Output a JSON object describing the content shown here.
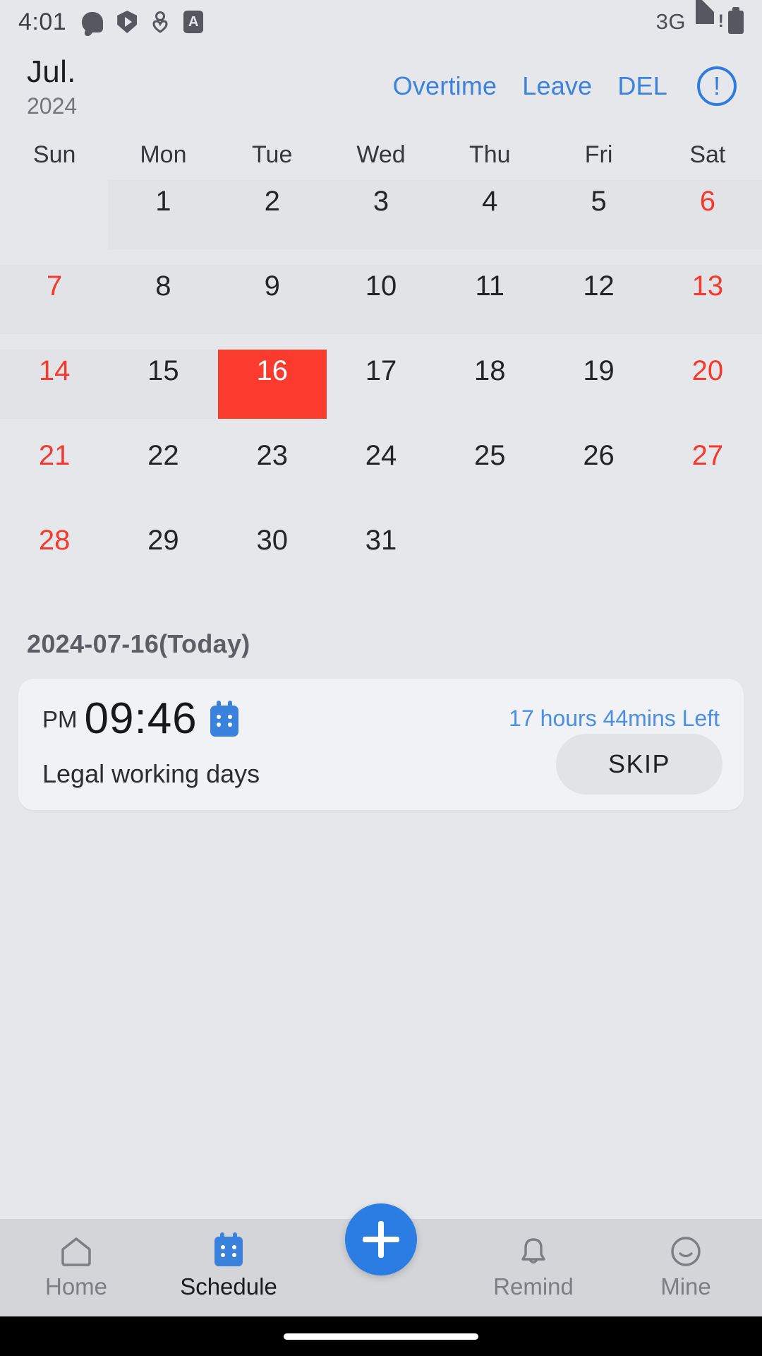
{
  "status_bar": {
    "time": "4:01",
    "left_icons": [
      "chat-icon",
      "shield-play-icon",
      "person-icon",
      "app-a-icon"
    ],
    "network": "3G",
    "right_icons": [
      "signal-warning-icon",
      "battery-icon"
    ]
  },
  "header": {
    "month": "Jul.",
    "year": "2024",
    "actions": [
      {
        "label": "Overtime",
        "name": "overtime-button"
      },
      {
        "label": "Leave",
        "name": "leave-button"
      },
      {
        "label": "DEL",
        "name": "del-button"
      }
    ],
    "info_icon": "!",
    "accent_blue": "#3b82dd"
  },
  "calendar": {
    "weekdays": [
      "Sun",
      "Mon",
      "Tue",
      "Wed",
      "Thu",
      "Fri",
      "Sat"
    ],
    "selected_color": "#fb3b2e",
    "weekend_color": "#f6392c",
    "weeks": [
      [
        {
          "day": "",
          "weekend": false,
          "selected": false,
          "tint": false
        },
        {
          "day": "1",
          "weekend": false,
          "selected": false,
          "tint": true
        },
        {
          "day": "2",
          "weekend": false,
          "selected": false,
          "tint": true
        },
        {
          "day": "3",
          "weekend": false,
          "selected": false,
          "tint": true
        },
        {
          "day": "4",
          "weekend": false,
          "selected": false,
          "tint": true
        },
        {
          "day": "5",
          "weekend": false,
          "selected": false,
          "tint": true
        },
        {
          "day": "6",
          "weekend": true,
          "selected": false,
          "tint": true
        }
      ],
      [
        {
          "day": "7",
          "weekend": true,
          "selected": false,
          "tint": true
        },
        {
          "day": "8",
          "weekend": false,
          "selected": false,
          "tint": true
        },
        {
          "day": "9",
          "weekend": false,
          "selected": false,
          "tint": true
        },
        {
          "day": "10",
          "weekend": false,
          "selected": false,
          "tint": true
        },
        {
          "day": "11",
          "weekend": false,
          "selected": false,
          "tint": true
        },
        {
          "day": "12",
          "weekend": false,
          "selected": false,
          "tint": true
        },
        {
          "day": "13",
          "weekend": true,
          "selected": false,
          "tint": true
        }
      ],
      [
        {
          "day": "14",
          "weekend": true,
          "selected": false,
          "tint": true
        },
        {
          "day": "15",
          "weekend": false,
          "selected": false,
          "tint": true
        },
        {
          "day": "16",
          "weekend": false,
          "selected": true,
          "tint": false
        },
        {
          "day": "17",
          "weekend": false,
          "selected": false,
          "tint": false
        },
        {
          "day": "18",
          "weekend": false,
          "selected": false,
          "tint": false
        },
        {
          "day": "19",
          "weekend": false,
          "selected": false,
          "tint": false
        },
        {
          "day": "20",
          "weekend": true,
          "selected": false,
          "tint": false
        }
      ],
      [
        {
          "day": "21",
          "weekend": true,
          "selected": false,
          "tint": false
        },
        {
          "day": "22",
          "weekend": false,
          "selected": false,
          "tint": false
        },
        {
          "day": "23",
          "weekend": false,
          "selected": false,
          "tint": false
        },
        {
          "day": "24",
          "weekend": false,
          "selected": false,
          "tint": false
        },
        {
          "day": "25",
          "weekend": false,
          "selected": false,
          "tint": false
        },
        {
          "day": "26",
          "weekend": false,
          "selected": false,
          "tint": false
        },
        {
          "day": "27",
          "weekend": true,
          "selected": false,
          "tint": false
        }
      ],
      [
        {
          "day": "28",
          "weekend": true,
          "selected": false,
          "tint": false
        },
        {
          "day": "29",
          "weekend": false,
          "selected": false,
          "tint": false
        },
        {
          "day": "30",
          "weekend": false,
          "selected": false,
          "tint": false
        },
        {
          "day": "31",
          "weekend": false,
          "selected": false,
          "tint": false
        },
        {
          "day": "",
          "weekend": false,
          "selected": false,
          "tint": false
        },
        {
          "day": "",
          "weekend": false,
          "selected": false,
          "tint": false
        },
        {
          "day": "",
          "weekend": false,
          "selected": false,
          "tint": false
        }
      ]
    ]
  },
  "today_label": "2024-07-16(Today)",
  "card": {
    "ampm": "PM",
    "time": "09:46",
    "calendar_icon": "calendar-icon",
    "time_left": "17 hours 44mins Left",
    "subtitle": "Legal working days",
    "skip_label": "SKIP"
  },
  "bottom_nav": {
    "items": [
      {
        "label": "Home",
        "icon": "home-icon",
        "active": false
      },
      {
        "label": "Schedule",
        "icon": "calendar-icon",
        "active": true
      },
      {
        "label": "Remind",
        "icon": "bell-icon",
        "active": false
      },
      {
        "label": "Mine",
        "icon": "smiley-icon",
        "active": false
      }
    ],
    "fab": "add-icon",
    "fab_color": "#2b7de4"
  }
}
